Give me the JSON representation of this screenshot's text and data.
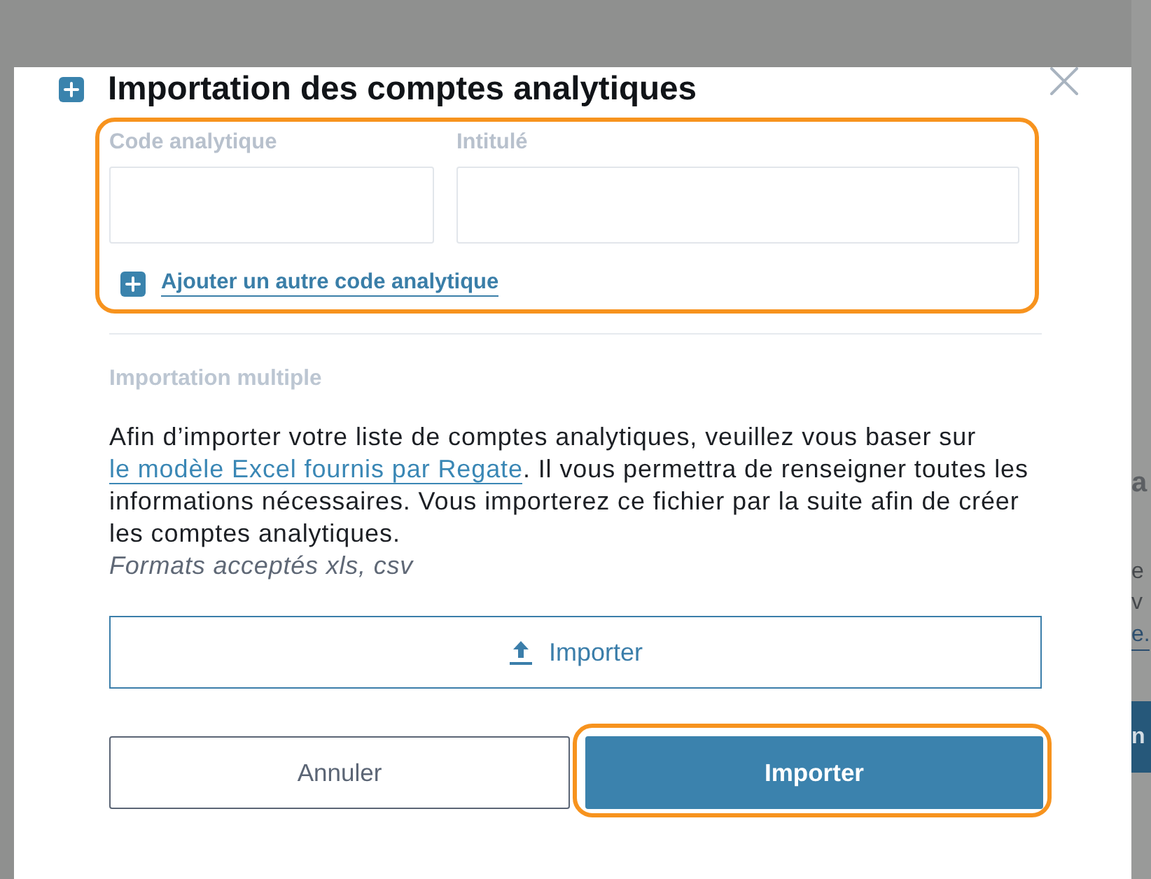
{
  "dialog": {
    "title": "Importation des comptes analytiques"
  },
  "single_entry": {
    "highlighted": true,
    "fields": [
      {
        "label": "Code analytique"
      },
      {
        "label": "Intitulé"
      }
    ],
    "add_link": "Ajouter un autre code analytique"
  },
  "multiple_import": {
    "heading": "Importation multiple",
    "description": {
      "before": "Afin d’importer votre liste de comptes analytiques, veuillez vous baser sur ",
      "link": "le modèle Excel fournis par Regate",
      "after": ". Il vous permettra de renseigner toutes les informations nécessaires. Vous importerez ce fichier par la suite afin de créer les comptes analytiques."
    },
    "formats": "Formats acceptés xls, csv",
    "upload_button": "Importer"
  },
  "buttons": [
    {
      "label": "Annuler",
      "kind": "secondary",
      "highlighted": false
    },
    {
      "label": "Importer",
      "kind": "primary",
      "highlighted": true
    }
  ],
  "background_page": {
    "heading": "a",
    "lines": [
      "e",
      "v"
    ],
    "link": "e.",
    "button": "n"
  }
}
